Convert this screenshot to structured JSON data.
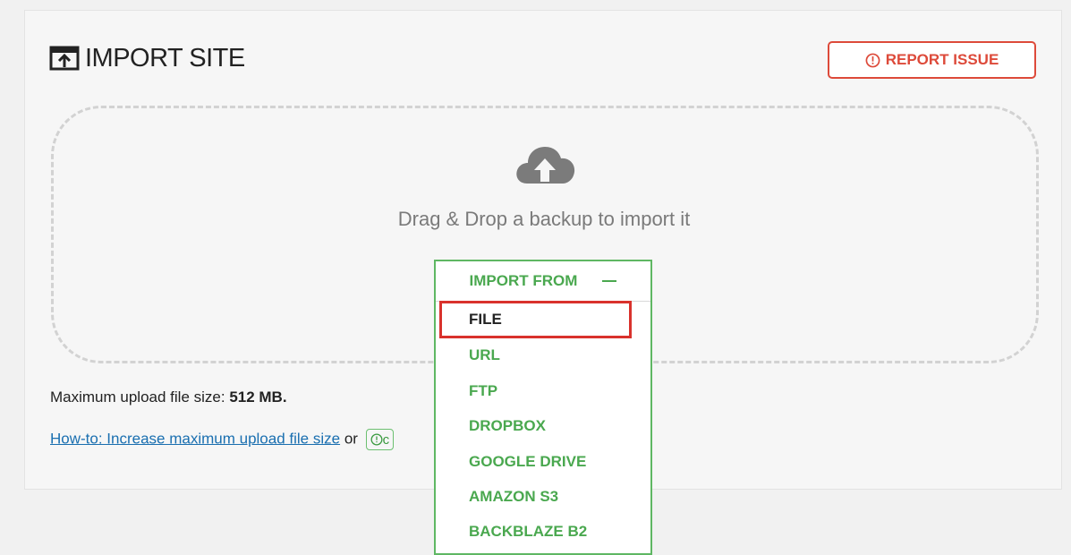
{
  "header": {
    "title": "IMPORT SITE",
    "report_button": "REPORT ISSUE"
  },
  "dropzone": {
    "text": "Drag & Drop a backup to import it",
    "icon": "cloud-upload-icon"
  },
  "info": {
    "max_size_label": "Maximum upload file size: ",
    "max_size_value": "512 MB.",
    "howto_link": "How-to: Increase maximum upload file size",
    "howto_or": "or",
    "help_badge": "c"
  },
  "import_menu": {
    "label": "IMPORT FROM",
    "items": [
      {
        "label": "FILE",
        "selected": true
      },
      {
        "label": "URL"
      },
      {
        "label": "FTP"
      },
      {
        "label": "DROPBOX"
      },
      {
        "label": "GOOGLE DRIVE"
      },
      {
        "label": "AMAZON S3"
      },
      {
        "label": "BACKBLAZE B2"
      }
    ]
  },
  "colors": {
    "accent_green": "#4aa84f",
    "report_red": "#dd4a3a",
    "highlight_red": "#d9322c",
    "link_blue": "#1a6fb0"
  }
}
